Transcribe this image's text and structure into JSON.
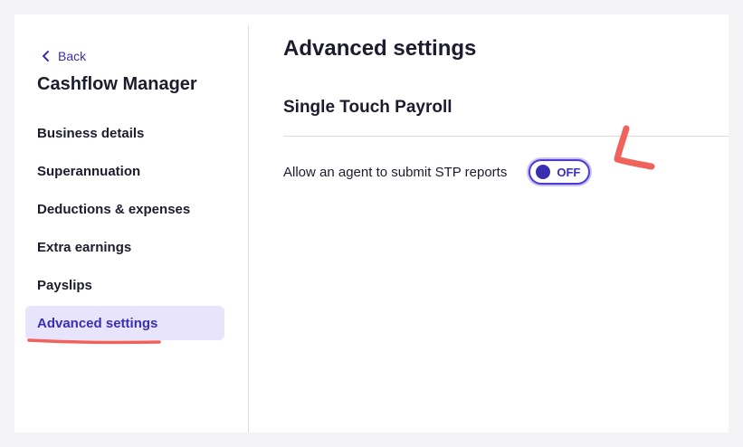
{
  "sidebar": {
    "back_label": "Back",
    "app_title": "Cashflow Manager",
    "items": [
      {
        "label": "Business details"
      },
      {
        "label": "Superannuation"
      },
      {
        "label": "Deductions & expenses"
      },
      {
        "label": "Extra earnings"
      },
      {
        "label": "Payslips"
      },
      {
        "label": "Advanced settings"
      }
    ],
    "active_item": "Advanced settings"
  },
  "main": {
    "page_title": "Advanced settings",
    "section_title": "Single Touch Payroll",
    "setting": {
      "label": "Allow an agent to submit STP reports",
      "toggle_state": "OFF"
    }
  },
  "colors": {
    "accent": "#3a2fb0",
    "active_bg": "#e8e4fb",
    "annotation": "#f0625c"
  }
}
